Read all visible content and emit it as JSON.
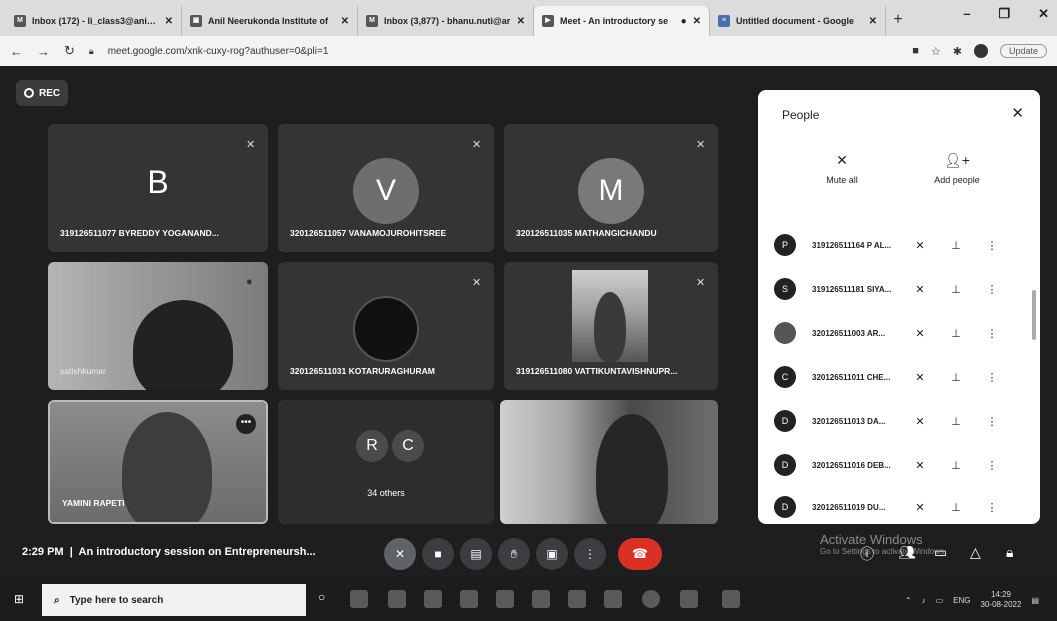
{
  "browser": {
    "tabs": [
      {
        "title": "Inbox (172) - li_class3@anits.e",
        "icon": "gmail-icon",
        "active": false
      },
      {
        "title": "Anil Neerukonda Institute of",
        "icon": "classroom-icon",
        "active": false
      },
      {
        "title": "Inbox (3,877) - bhanu.nuti@ar",
        "icon": "gmail-icon",
        "active": false
      },
      {
        "title": "Meet - An introductory se",
        "icon": "meet-icon",
        "active": true
      },
      {
        "title": "Untitled document - Google",
        "icon": "docs-icon",
        "active": false
      }
    ],
    "url": "meet.google.com/xnk-cuxy-rog?authuser=0&pli=1",
    "update_label": "Update"
  },
  "meet": {
    "rec_label": "REC",
    "tiles": [
      {
        "name": "319126511077 BYREDDY YOGANAND...",
        "letter": "B"
      },
      {
        "name": "320126511057 VANAMOJUROHITSREE",
        "letter": "V"
      },
      {
        "name": "320126511035 MATHANGICHANDU",
        "letter": "M"
      },
      {
        "name": "satishkumar",
        "letter": ""
      },
      {
        "name": "320126511031 KOTARURAGHURAM",
        "letter": ""
      },
      {
        "name": "319126511080 VATTIKUNTAVISHNUPR...",
        "letter": ""
      },
      {
        "name": "YAMINI RAPETI",
        "letter": ""
      },
      {
        "name": "34 others",
        "letter": "R C"
      },
      {
        "name": "",
        "letter": ""
      }
    ],
    "others_letters": [
      "R",
      "C"
    ],
    "others_label": "34 others",
    "time": "2:29 PM",
    "separator": "|",
    "meeting_title": "An introductory session on Entrepreneursh...",
    "activate": {
      "title": "Activate Windows",
      "sub": "Go to Settings to activate Windows."
    }
  },
  "panel": {
    "title": "People",
    "mute_all": "Mute all",
    "add_people": "Add people",
    "participants": [
      {
        "initial": "P",
        "name": "319126511164 P AL..."
      },
      {
        "initial": "S",
        "name": "319126511181 SIYA..."
      },
      {
        "initial": "",
        "name": "320126511003 AR..."
      },
      {
        "initial": "C",
        "name": "320126511011 CHE..."
      },
      {
        "initial": "D",
        "name": "320126511013 DA..."
      },
      {
        "initial": "D",
        "name": "320126511016 DEB..."
      },
      {
        "initial": "D",
        "name": "320126511019 DU..."
      }
    ]
  },
  "taskbar": {
    "search_placeholder": "Type here to search",
    "lang": "ENG",
    "time": "14:29",
    "date": "30-08-2022"
  }
}
